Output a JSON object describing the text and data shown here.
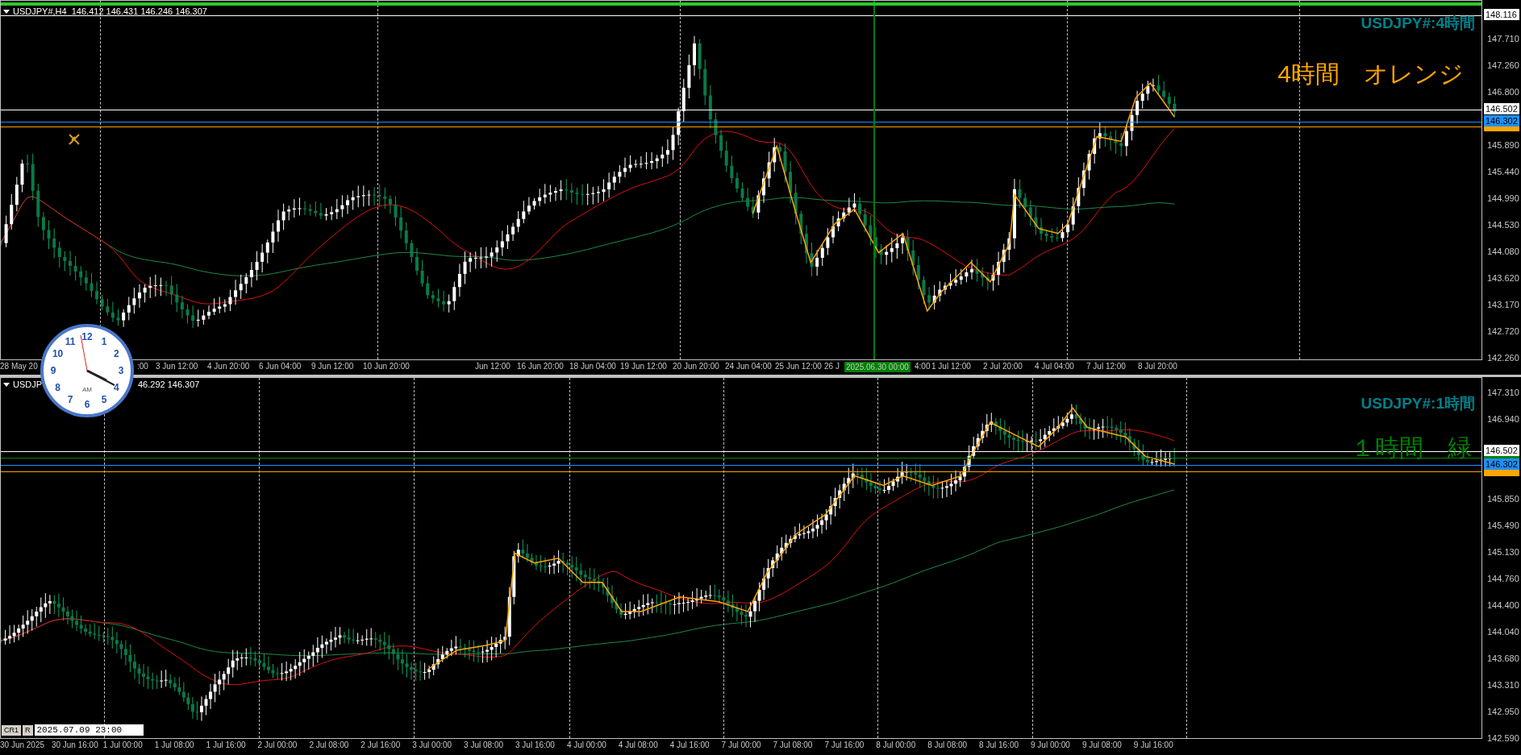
{
  "top_chart": {
    "header": "USDJPY#,H4  146.412 146.431 146.246 146.307",
    "symbol_label": "USDJPY#:4時間",
    "note": "4時間　オレンジ",
    "price_axis": [
      "147.710",
      "147.260",
      "146.800",
      "145.890",
      "145.440",
      "144.990",
      "144.530",
      "144.080",
      "143.620",
      "143.170",
      "142.720",
      "142.260"
    ],
    "price_tags": [
      {
        "kind": "white",
        "text": "148.116"
      },
      {
        "kind": "white",
        "text": "146.502"
      },
      {
        "kind": "orange"
      },
      {
        "kind": "blue",
        "text": "146.302"
      }
    ],
    "time_axis": [
      "28 May 20",
      ":00",
      "3 Jun 12:00",
      "4 Jun 20:00",
      "6 Jun 04:00",
      "9 Jun 12:00",
      "10 Jun 20:00",
      "Jun 12:00",
      "16 Jun 20:00",
      "18 Jun 04:00",
      "19 Jun 12:00",
      "20 Jun 20:00",
      "24 Jun 04:00",
      "25 Jun 12:00",
      "26 J",
      "4:00",
      "1 Jul 12:00",
      "2 Jul 20:00",
      "4 Jul 04:00",
      "7 Jul 12:00",
      "8 Jul 20:00"
    ],
    "cursor_time": "2025.06.30 00:00"
  },
  "bottom_chart": {
    "header_parts": [
      "USDJP",
      "46.292 146.307"
    ],
    "symbol_label": "USDJPY#:1時間",
    "note": "１時間　緑",
    "price_axis": [
      "147.310",
      "146.940",
      "145.850",
      "145.490",
      "145.130",
      "144.760",
      "144.400",
      "144.040",
      "143.680",
      "143.310",
      "142.950",
      "142.590"
    ],
    "price_tags": [
      {
        "kind": "green"
      },
      {
        "kind": "orange"
      },
      {
        "kind": "white",
        "text": "146.502"
      },
      {
        "kind": "blue",
        "text": "146.302"
      }
    ],
    "time_axis": [
      "30 Jun 2025",
      "30 Jun 16:00",
      "1 Jul 00:00",
      "1 Jul 08:00",
      "1 Jul 16:00",
      "2 Jul 00:00",
      "2 Jul 08:00",
      "2 Jul 16:00",
      "3 Jul 00:00",
      "3 Jul 08:00",
      "3 Jul 16:00",
      "4 Jul 00:00",
      "4 Jul 08:00",
      "4 Jul 16:00",
      "7 Jul 00:00",
      "7 Jul 08:00",
      "7 Jul 16:00",
      "8 Jul 00:00",
      "8 Jul 08:00",
      "8 Jul 16:00",
      "9 Jul 00:00",
      "9 Jul 08:00",
      "9 Jul 16:00"
    ]
  },
  "clock": {
    "numbers": [
      "12",
      "11",
      "1",
      "10",
      "2",
      "9",
      "3",
      "8",
      "4",
      "7",
      "5",
      "6"
    ],
    "period": "AM"
  },
  "status": {
    "tabs": [
      "CR1",
      "R"
    ],
    "time": "2025.07.09 23:00"
  }
}
